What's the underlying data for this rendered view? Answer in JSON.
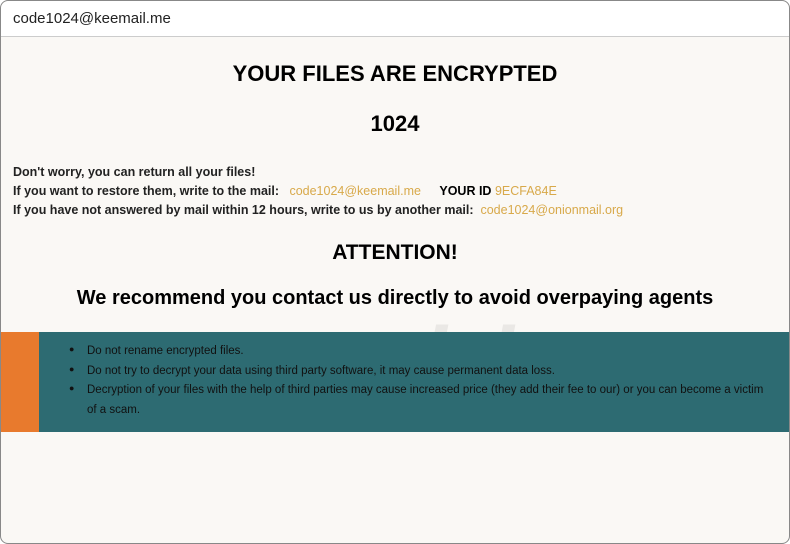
{
  "titlebar": {
    "title": "code1024@keemail.me"
  },
  "headings": {
    "main": "YOUR FILES ARE ENCRYPTED",
    "number": "1024",
    "attention": "ATTENTION!",
    "recommend": "We recommend you contact us directly to avoid overpaying agents"
  },
  "info": {
    "line1": "Don't worry, you can return all your files!",
    "line2_prefix": "If you want to restore them, write to the mail:",
    "line2_email": "code1024@keemail.me",
    "line2_id_label": "YOUR ID",
    "line2_id_value": "9ECFA84E",
    "line3_prefix": "If you have not answered by mail within 12 hours, write to us by another mail:",
    "line3_email": "code1024@onionmail.org"
  },
  "warnings": {
    "item1": "Do not rename encrypted files.",
    "item2": "Do not try to decrypt your data using third party software, it may cause permanent data loss.",
    "item3": "Decryption of your files with the help of third parties may cause increased price (they add their fee to our) or you can become a victim of a scam."
  },
  "watermark": "risk.com"
}
